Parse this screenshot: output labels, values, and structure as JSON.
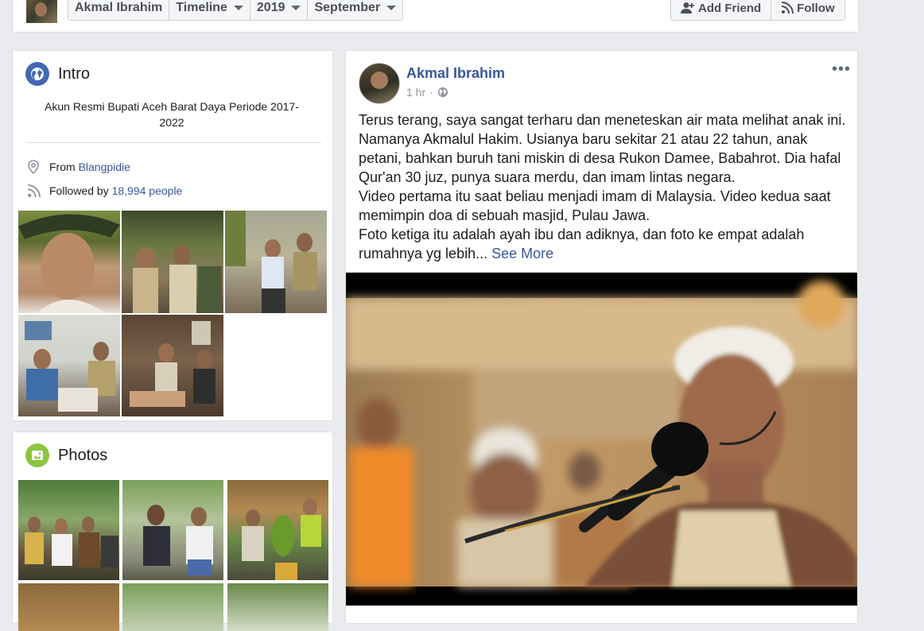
{
  "header": {
    "profile_name": "Akmal Ibrahim",
    "crumbs": [
      "Timeline",
      "2019",
      "September"
    ],
    "add_friend_label": "Add Friend",
    "follow_label": "Follow"
  },
  "intro": {
    "title": "Intro",
    "description": "Akun Resmi Bupati Aceh Barat Daya Periode 2017-2022",
    "from_prefix": "From",
    "from_place": "Blangpidie",
    "followed_prefix": "Followed by",
    "followed_count": "18,994 people"
  },
  "photos": {
    "title": "Photos"
  },
  "post": {
    "author": "Akmal Ibrahim",
    "time": "1 hr",
    "separator": "·",
    "paragraphs": [
      "Terus terang, saya sangat terharu dan meneteskan air mata melihat anak ini. Namanya Akmalul Hakim. Usianya baru sekitar 21 atau 22 tahun, anak petani, bahkan buruh tani miskin di desa Rukon Damee, Babahrot. Dia hafal Qur'an 30 juz, punya suara merdu, dan imam lintas negara.",
      "Video pertama itu saat beliau menjadi imam di Malaysia. Video kedua saat memimpin doa di sebuah masjid, Pulau Jawa."
    ],
    "last_paragraph": "Foto ketiga itu adalah ayah ibu dan adiknya, dan foto ke empat adalah rumahnya yg lebih...",
    "see_more": "See More"
  },
  "colors": {
    "link": "#385898",
    "page_bg": "#e9ebee",
    "intro_icon": "#4267b2",
    "photos_icon": "#8dc63f"
  }
}
